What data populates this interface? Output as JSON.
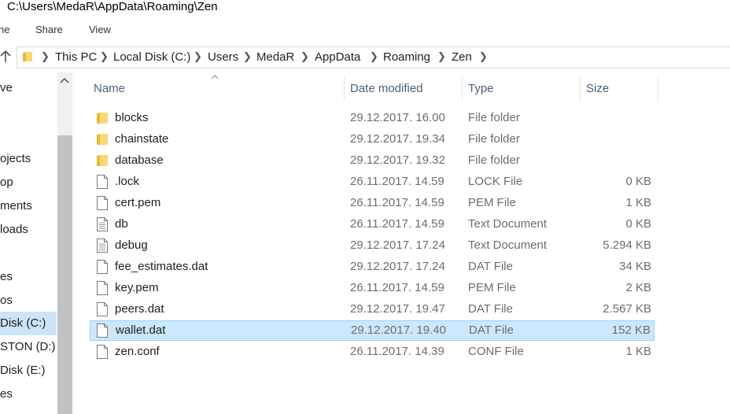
{
  "window": {
    "title": "C:\\Users\\MedaR\\AppData\\Roaming\\Zen"
  },
  "ribbon": {
    "tabs": [
      "ne",
      "Share",
      "View"
    ]
  },
  "address": {
    "crumbs": [
      "This PC",
      "Local Disk (C:)",
      "Users",
      "MedaR",
      "AppData",
      "Roaming",
      "Zen"
    ]
  },
  "nav": {
    "items": [
      {
        "label": "ve"
      },
      {
        "label": "ojects"
      },
      {
        "label": "op"
      },
      {
        "label": "ments"
      },
      {
        "label": "loads"
      },
      {
        "label": ""
      },
      {
        "label": "es"
      },
      {
        "label": "os"
      },
      {
        "label": "Disk (C:)",
        "selected": true
      },
      {
        "label": "STON (D:)"
      },
      {
        "label": "Disk (E:)"
      },
      {
        "label": "es"
      }
    ]
  },
  "columns": {
    "name": "Name",
    "date": "Date modified",
    "type": "Type",
    "size": "Size"
  },
  "files": [
    {
      "name": "blocks",
      "date": "29.12.2017. 16.00",
      "type": "File folder",
      "size": "",
      "icon": "folder-icon"
    },
    {
      "name": "chainstate",
      "date": "29.12.2017. 19.34",
      "type": "File folder",
      "size": "",
      "icon": "folder-icon"
    },
    {
      "name": "database",
      "date": "29.12.2017. 19.32",
      "type": "File folder",
      "size": "",
      "icon": "folder-icon"
    },
    {
      "name": ".lock",
      "date": "26.11.2017. 14.59",
      "type": "LOCK File",
      "size": "0 KB",
      "icon": "file-icon"
    },
    {
      "name": "cert.pem",
      "date": "26.11.2017. 14.59",
      "type": "PEM File",
      "size": "1 KB",
      "icon": "file-icon"
    },
    {
      "name": "db",
      "date": "26.11.2017. 14.59",
      "type": "Text Document",
      "size": "0 KB",
      "icon": "text-document-icon"
    },
    {
      "name": "debug",
      "date": "29.12.2017. 17.24",
      "type": "Text Document",
      "size": "5.294 KB",
      "icon": "text-document-icon"
    },
    {
      "name": "fee_estimates.dat",
      "date": "29.12.2017. 17.24",
      "type": "DAT File",
      "size": "34 KB",
      "icon": "file-icon"
    },
    {
      "name": "key.pem",
      "date": "26.11.2017. 14.59",
      "type": "PEM File",
      "size": "2 KB",
      "icon": "file-icon"
    },
    {
      "name": "peers.dat",
      "date": "29.12.2017. 19.47",
      "type": "DAT File",
      "size": "2.567 KB",
      "icon": "file-icon"
    },
    {
      "name": "wallet.dat",
      "date": "29.12.2017. 19.40",
      "type": "DAT File",
      "size": "152 KB",
      "icon": "file-icon",
      "selected": true
    },
    {
      "name": "zen.conf",
      "date": "26.11.2017. 14.39",
      "type": "CONF File",
      "size": "1 KB",
      "icon": "file-icon"
    }
  ],
  "colors": {
    "selection": "#cce8ff",
    "selection_border": "#99d1ff",
    "folder": "#f8d775",
    "header_text": "#4c607a"
  }
}
